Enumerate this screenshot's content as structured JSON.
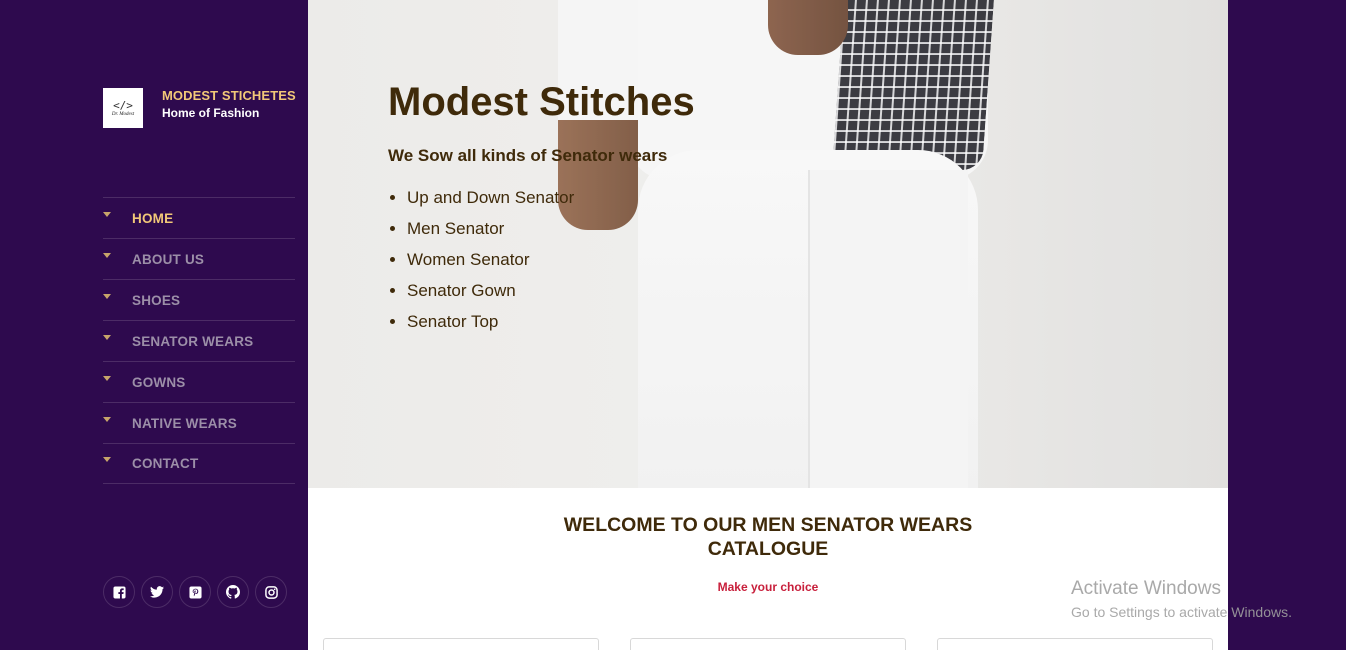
{
  "brand": {
    "name": "MODEST STICHETES",
    "tagline": "Home of Fashion",
    "logo_text": "</>",
    "logo_small": "Dr. Modest"
  },
  "nav": {
    "items": [
      {
        "label": "HOME",
        "active": true
      },
      {
        "label": "ABOUT US",
        "active": false
      },
      {
        "label": "SHOES",
        "active": false
      },
      {
        "label": "SENATOR WEARS",
        "active": false
      },
      {
        "label": "GOWNS",
        "active": false
      },
      {
        "label": "NATIVE WEARS",
        "active": false
      },
      {
        "label": "CONTACT",
        "active": false
      }
    ]
  },
  "social": {
    "icons": [
      "facebook-icon",
      "twitter-icon",
      "pinterest-icon",
      "github-icon",
      "instagram-icon"
    ],
    "glyphs": [
      "f",
      "🐦",
      "p",
      "◉",
      "◎"
    ]
  },
  "hero": {
    "title": "Modest Stitches",
    "subtitle": "We Sow all kinds of Senator wears",
    "list": [
      "Up and Down Senator",
      "Men Senator",
      "Women Senator",
      "Senator Gown",
      "Senator Top"
    ]
  },
  "section": {
    "welcome_line1": "WELCOME TO OUR MEN SENATOR WEARS",
    "welcome_line2": "CATALOGUE",
    "choice": "Make your choice"
  },
  "watermark": {
    "line1": "Activate Windows",
    "line2": "Go to Settings to activate Windows."
  },
  "colors": {
    "sidebar_bg": "#2e0a4e",
    "accent_gold": "#f2c878",
    "heading_brown": "#3f2a0a",
    "choice_red": "#c8203c"
  }
}
